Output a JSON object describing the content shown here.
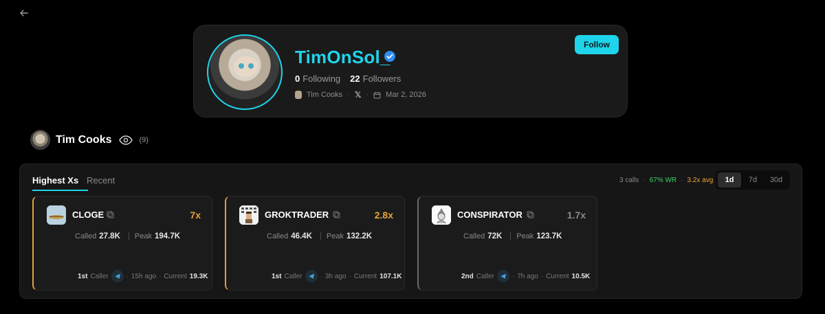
{
  "profile": {
    "name": "TimOnSol_",
    "following_count": "0",
    "following_label": "Following",
    "followers_count": "22",
    "followers_label": "Followers",
    "channel_name": "Tim Cooks",
    "joined": "Mar 2, 2026",
    "follow_label": "Follow",
    "accent": "#1fd4ea"
  },
  "channel": {
    "name": "Tim Cooks",
    "watch_count": "(9)"
  },
  "tabs": {
    "highest": "Highest Xs",
    "recent": "Recent"
  },
  "summary": {
    "calls": "3 calls",
    "win_rate": "67% WR",
    "avg": "3.2x avg"
  },
  "ranges": [
    "1d",
    "7d",
    "30d"
  ],
  "active_range": "1d",
  "labels": {
    "called": "Called",
    "peak": "Peak",
    "caller": "Caller",
    "current": "Current"
  },
  "calls": [
    {
      "token": "CLOGE",
      "multiplier": "7x",
      "multiplier_color": "#e8a33a",
      "called": "27.8K",
      "peak": "194.7K",
      "rank": "1st",
      "ago": "15h ago",
      "current": "19.3K",
      "icon": "cloge-token-icon"
    },
    {
      "token": "GROKTRADER",
      "multiplier": "2.8x",
      "multiplier_color": "#e8a33a",
      "called": "46.4K",
      "peak": "132.2K",
      "rank": "1st",
      "ago": "3h ago",
      "current": "107.1K",
      "icon": "groktrader-token-icon"
    },
    {
      "token": "CONSPIRATOR",
      "multiplier": "1.7x",
      "multiplier_color": "#8a8a8a",
      "called": "72K",
      "peak": "123.7K",
      "rank": "2nd",
      "ago": "7h ago",
      "current": "10.5K",
      "icon": "conspirator-token-icon"
    }
  ]
}
